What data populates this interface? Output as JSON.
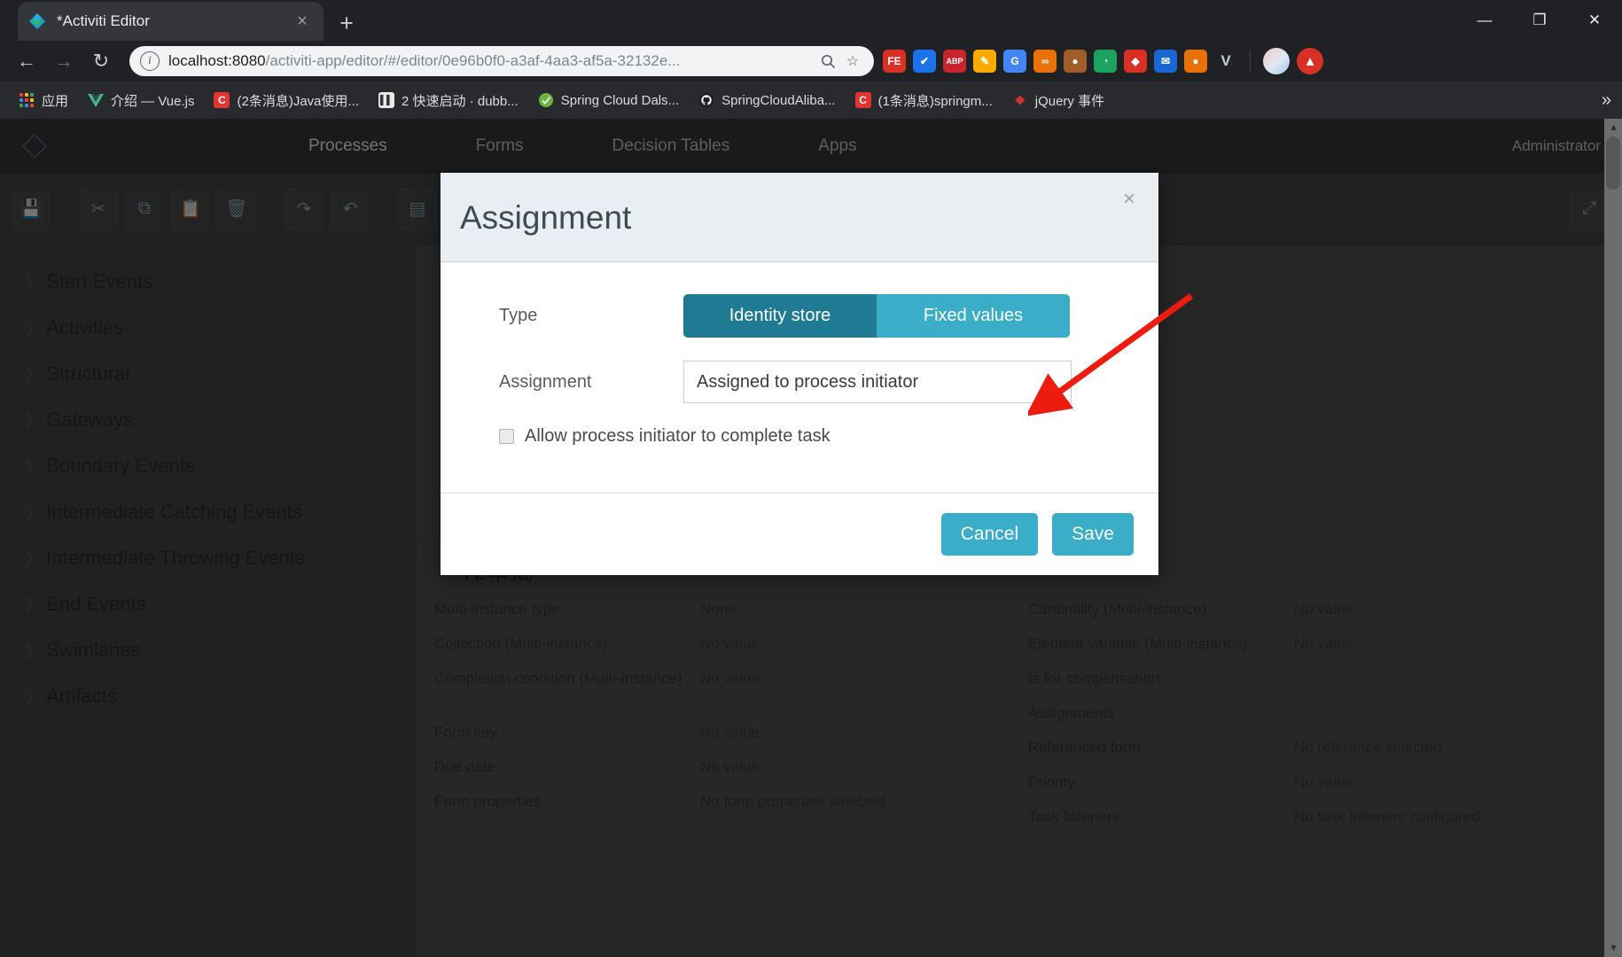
{
  "browser": {
    "tab": {
      "title": "*Activiti Editor",
      "favicon": "activiti-diamond-icon",
      "close": "×"
    },
    "new_tab": "+",
    "window_controls": {
      "minimize": "—",
      "maximize": "❐",
      "close": "✕"
    },
    "nav": {
      "back": "←",
      "forward": "→",
      "reload": "↻"
    },
    "omnibox": {
      "info_icon": "i",
      "host": "localhost:8080",
      "path": "/activiti-app/editor/#/editor/0e96b0f0-a3af-4aa3-af5a-32132e...",
      "zoom_icon": "🔍",
      "star_icon": "☆"
    },
    "extensions": [
      {
        "name": "fe-extension",
        "label": "FE",
        "color": "#d93025"
      },
      {
        "name": "check-extension",
        "label": "✔",
        "color": "#1a73e8"
      },
      {
        "name": "adblock-plus-extension",
        "label": "ABP",
        "color": "#c9252d"
      },
      {
        "name": "notes-extension",
        "label": "✎",
        "color": "#f9ab00"
      },
      {
        "name": "google-translate-extension",
        "label": "G",
        "color": "#4285f4"
      },
      {
        "name": "infinity-extension",
        "label": "∞",
        "color": "#e8710a"
      },
      {
        "name": "tiger-extension",
        "label": "🐯",
        "color": "#a15c2a"
      },
      {
        "name": "leaf-extension",
        "label": "◗",
        "color": "#1aa260"
      },
      {
        "name": "red-extension",
        "label": "◆",
        "color": "#d93025"
      },
      {
        "name": "blue-mail-extension",
        "label": "✉",
        "color": "#1967d2"
      },
      {
        "name": "orange-extension",
        "label": "●",
        "color": "#e8710a"
      },
      {
        "name": "v-extension",
        "label": "V",
        "color": "#5f6368"
      }
    ],
    "profile_avatar": "user-avatar",
    "menu": "⋮",
    "bookmarks": [
      {
        "label": "应用",
        "icon": "apps-grid-icon",
        "icon_color": "#5f6368"
      },
      {
        "label": "介绍 — Vue.js",
        "icon": "vue-icon",
        "icon_color": "#41b883"
      },
      {
        "label": "(2条消息)Java使用...",
        "icon": "csdn-icon",
        "icon_color": "#e3342f"
      },
      {
        "label": "2 快速启动 · dubb...",
        "icon": "dubbo-icon",
        "icon_color": "#e2e2e2"
      },
      {
        "label": "Spring Cloud Dals...",
        "icon": "spring-icon",
        "icon_color": "#6db33f"
      },
      {
        "label": "SpringCloudAliba...",
        "icon": "github-icon",
        "icon_color": "#24292e"
      },
      {
        "label": "(1条消息)springm...",
        "icon": "csdn-icon",
        "icon_color": "#e3342f"
      },
      {
        "label": "jQuery 事件",
        "icon": "jquery-icon",
        "icon_color": "#d63031"
      }
    ],
    "bookmarks_overflow": "»"
  },
  "app": {
    "logo": "activiti-logo-icon",
    "nav": [
      {
        "label": "Processes",
        "active": true
      },
      {
        "label": "Forms",
        "active": false
      },
      {
        "label": "Decision Tables",
        "active": false
      },
      {
        "label": "Apps",
        "active": false
      }
    ],
    "user": "Administrator",
    "toolbar": [
      {
        "name": "save-tool",
        "glyph": "💾"
      },
      {
        "name": "cut-tool",
        "glyph": "✂"
      },
      {
        "name": "copy-tool",
        "glyph": "⧉"
      },
      {
        "name": "paste-tool",
        "glyph": "📋"
      },
      {
        "name": "delete-tool",
        "glyph": "🗑"
      },
      {
        "name": "redo-tool",
        "glyph": "↷"
      },
      {
        "name": "undo-tool",
        "glyph": "↶"
      },
      {
        "name": "align-tool",
        "glyph": "▤"
      }
    ],
    "toolbar_right": [
      {
        "name": "fullscreen-tool",
        "glyph": "⤢"
      }
    ],
    "palette": [
      "Start Events",
      "Activities",
      "Structural",
      "Gateways",
      "Boundary Events",
      "Intermediate Catching Events",
      "Intermediate Throwing Events",
      "End Events",
      "Swimlanes",
      "Artifacts"
    ],
    "palette_chevron": "❯",
    "properties": {
      "title": "TL审批",
      "collapse_icon": "⌄",
      "left": [
        {
          "key": "Multi-instance type :",
          "value": "None"
        },
        {
          "key": "Collection (Multi-instance) :",
          "value": "No value"
        },
        {
          "key": "Completion condition (Multi-instance) :",
          "value": "No value"
        },
        {
          "key": "Form key :",
          "value": "No value"
        },
        {
          "key": "Due date :",
          "value": "No value"
        },
        {
          "key": "Form properties :",
          "value": "No form properties selected"
        }
      ],
      "right": [
        {
          "key": "Cardinality (Multi-instance) :",
          "value": "No value"
        },
        {
          "key": "Element variable (Multi-instance) :",
          "value": "No value"
        },
        {
          "key": "Is for compensation :",
          "value": ""
        },
        {
          "key": "Assignments :",
          "value": ""
        },
        {
          "key": "Referenced form :",
          "value": "No reference selected"
        },
        {
          "key": "Priority :",
          "value": "No value"
        },
        {
          "key": "Task listeners :",
          "value": "No task listeners configured"
        }
      ]
    }
  },
  "modal": {
    "title": "Assignment",
    "close_icon": "×",
    "type_label": "Type",
    "type_options": [
      {
        "label": "Identity store",
        "selected": true
      },
      {
        "label": "Fixed values",
        "selected": false
      }
    ],
    "assignment_label": "Assignment",
    "assignment_value": "Assigned to process initiator",
    "assignment_placeholder": "",
    "checkbox_label": "Allow process initiator to complete task",
    "checkbox_checked": false,
    "cancel_label": "Cancel",
    "save_label": "Save"
  },
  "annotation": {
    "arrow_color": "#ee1b11",
    "arrow_name": "red-pointer-arrow"
  },
  "colors": {
    "accent_teal": "#3aadc9",
    "accent_teal_dark": "#1e7b93",
    "modal_header_bg": "#e9eef2",
    "chrome_dark": "#202124",
    "bookmark_bar": "#292a2d"
  }
}
